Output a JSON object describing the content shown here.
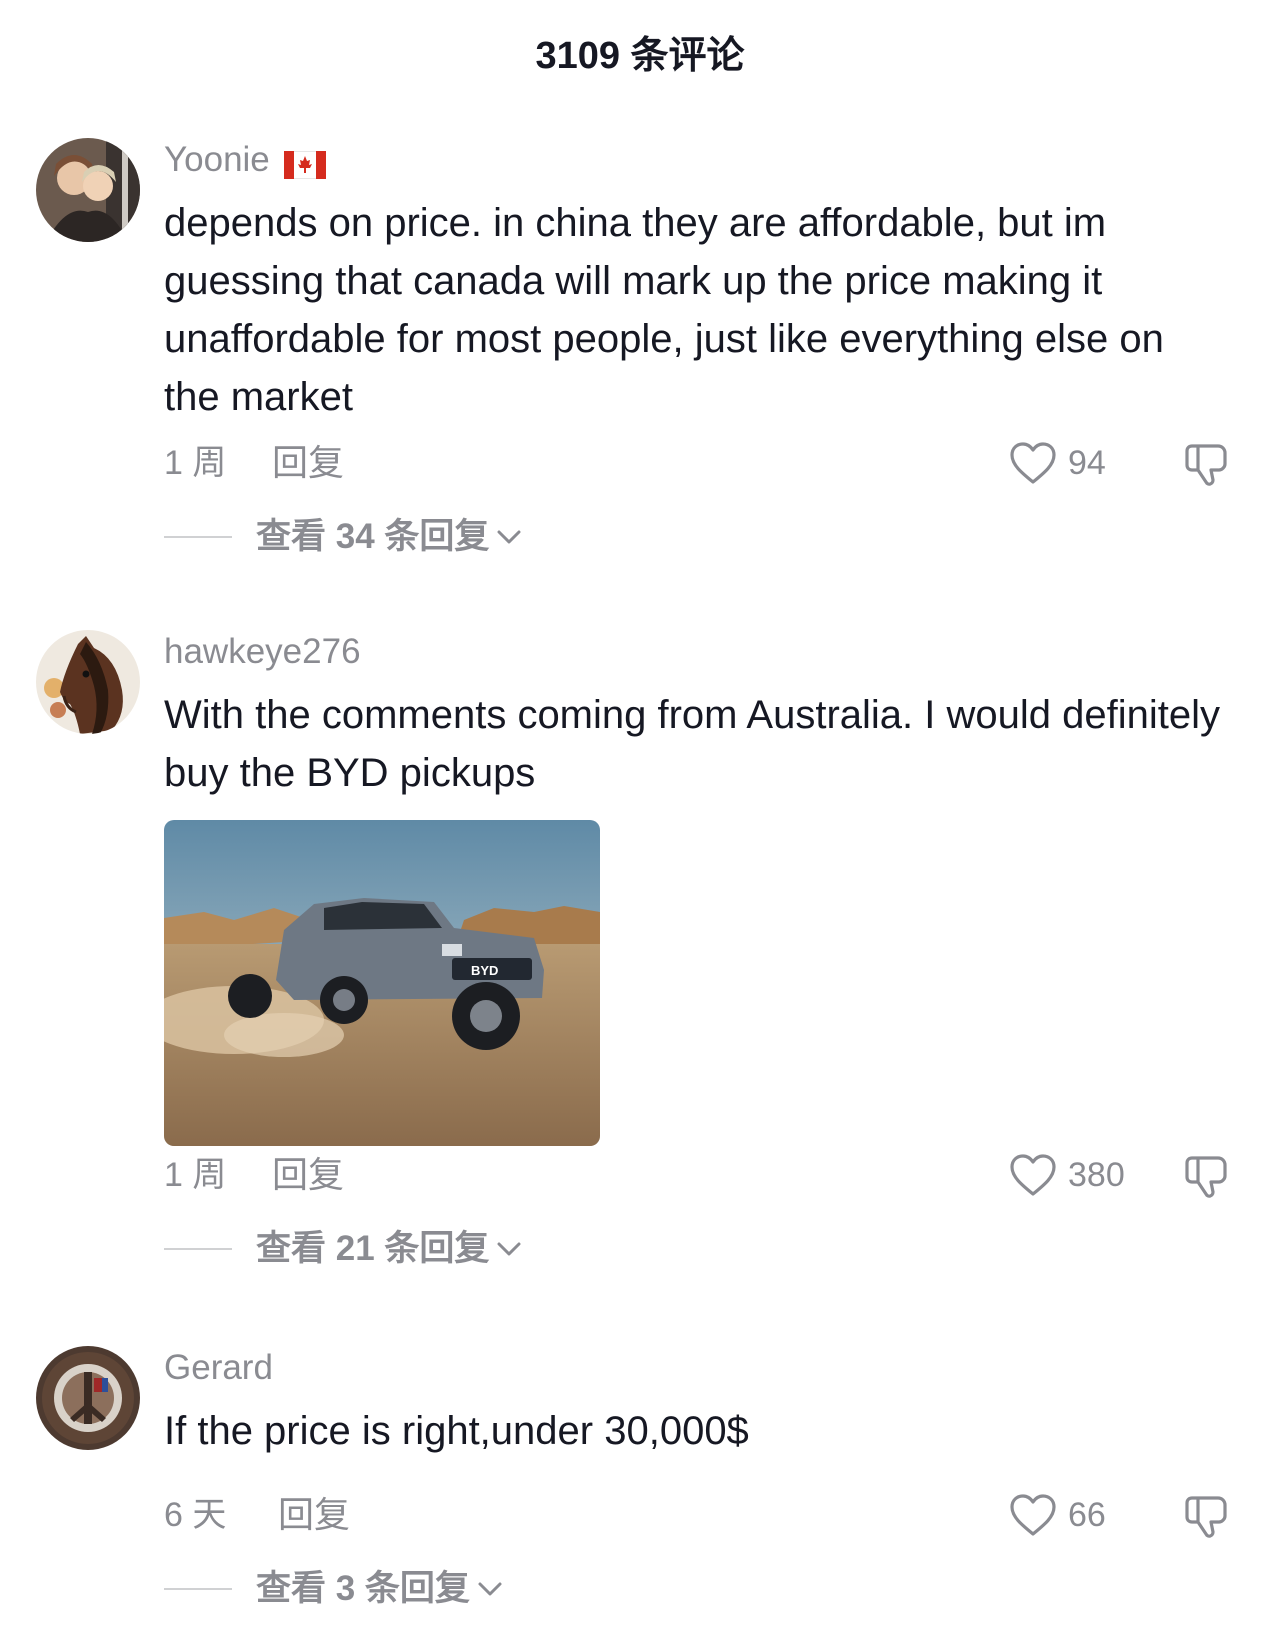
{
  "header": {
    "title": "3109 条评论"
  },
  "comments": [
    {
      "username": "Yoonie",
      "has_flag": true,
      "flag_icon": "canada-flag-icon",
      "text": "depends on price. in china they are affordable, but im guessing that canada will mark up the price making it unaffordable for most people, just like everything else on the market",
      "time": "1 周",
      "reply_label": "回复",
      "likes": "94",
      "view_replies": "查看 34 条回复"
    },
    {
      "username": "hawkeye276",
      "has_flag": false,
      "text": "With the comments coming from Australia. I would definitely buy the BYD pickups",
      "image_label": "BYD",
      "time": "1 周",
      "reply_label": "回复",
      "likes": "380",
      "view_replies": "查看 21 条回复"
    },
    {
      "username": "Gerard",
      "has_flag": false,
      "text": "If the price is right,under 30,000$",
      "time": "6 天",
      "reply_label": "回复",
      "likes": "66",
      "view_replies": "查看 3 条回复"
    }
  ],
  "colors": {
    "text_primary": "#161823",
    "text_secondary": "#8a8b91",
    "divider": "#d0d1d3"
  },
  "icons": [
    "heart-icon",
    "dislike-icon",
    "chevron-down-icon",
    "canada-flag-icon"
  ]
}
